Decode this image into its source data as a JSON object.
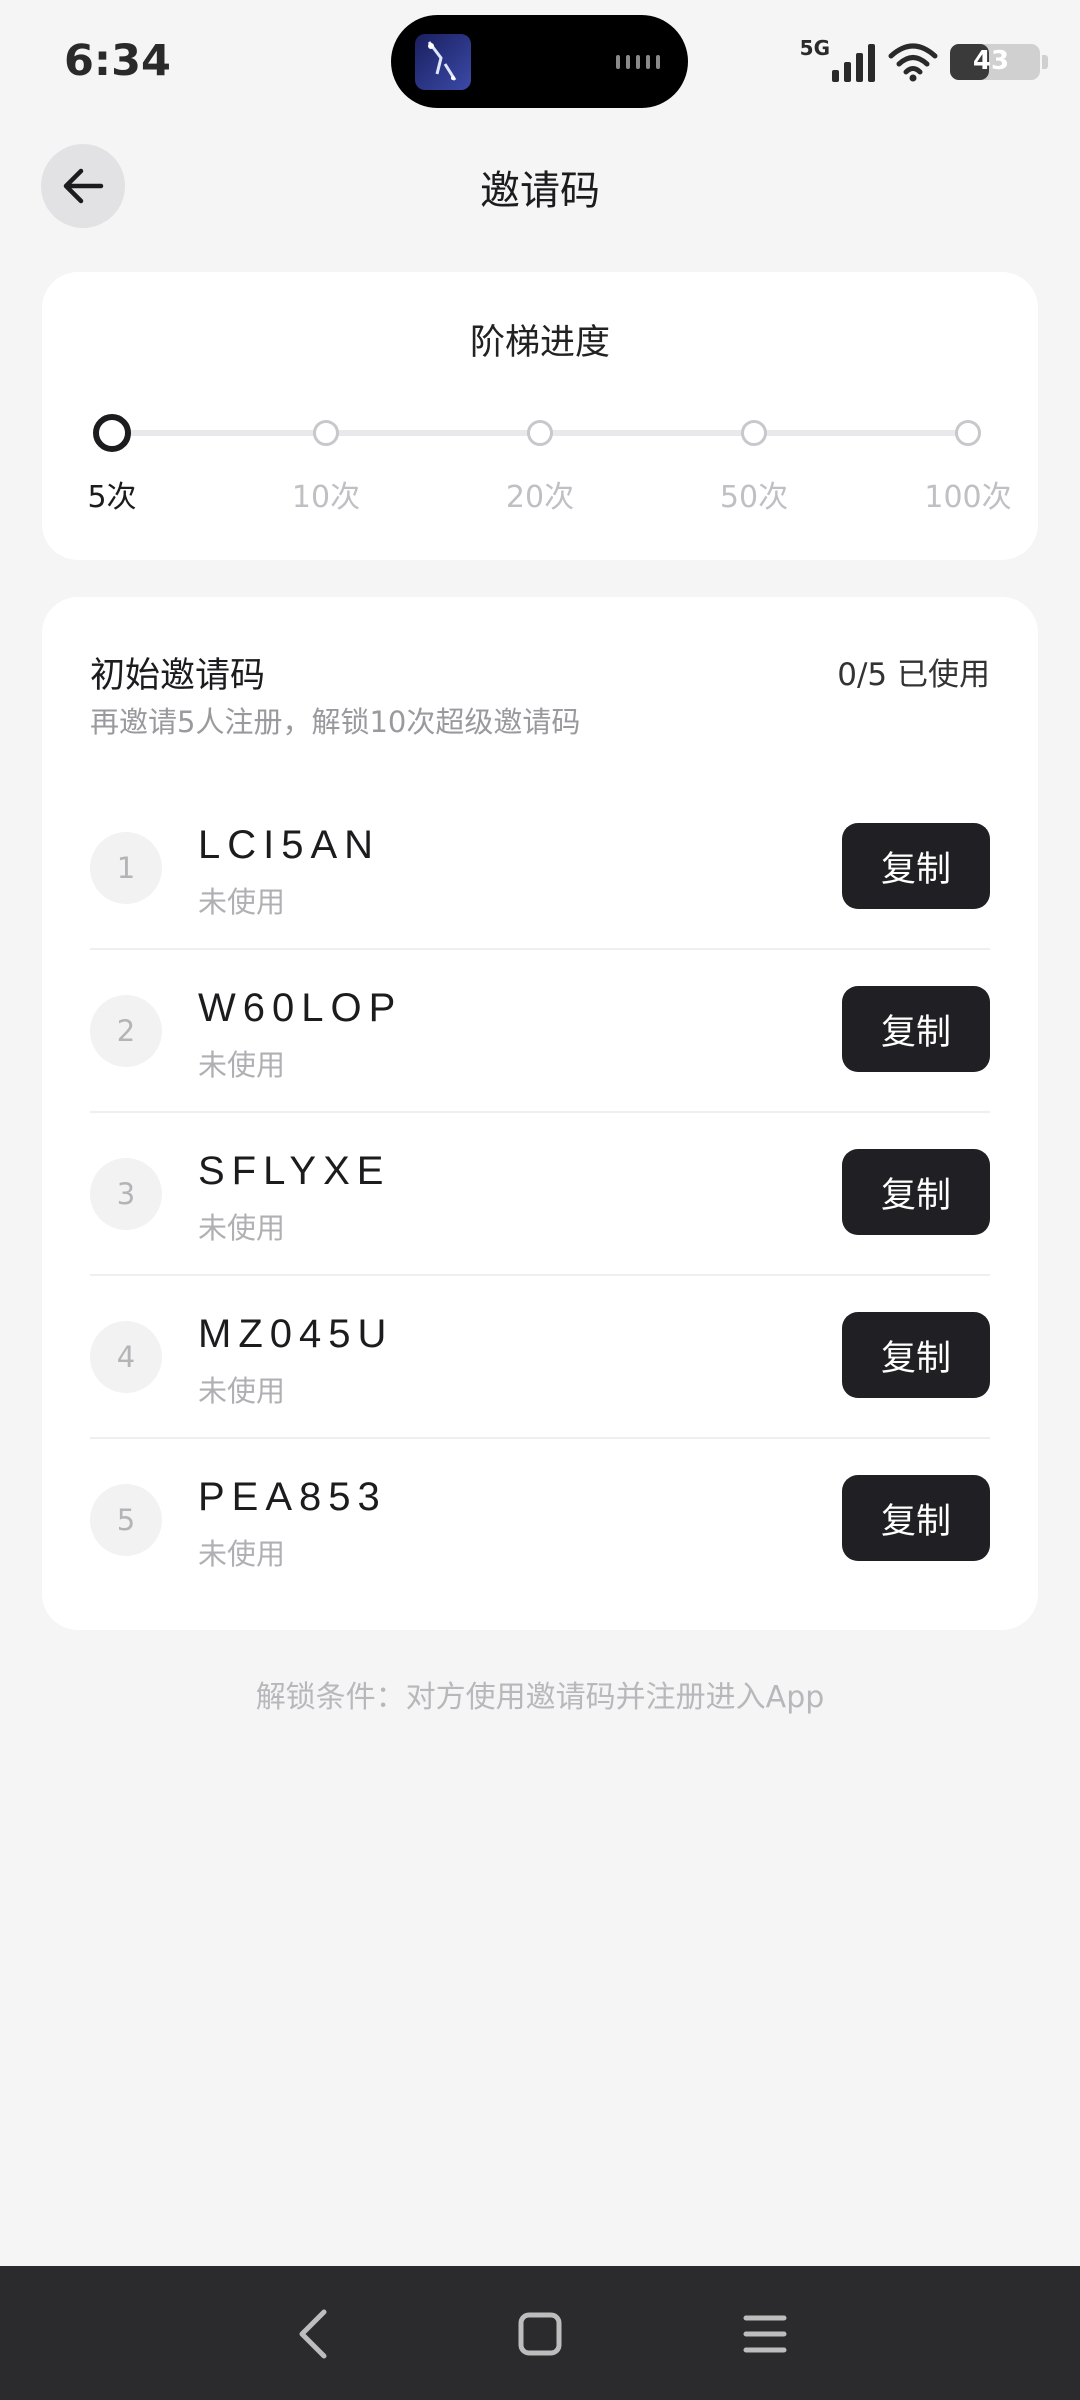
{
  "status_bar": {
    "time": "6:34",
    "network": "5G",
    "battery": "43",
    "battery_level": 0.43
  },
  "header": {
    "title": "邀请码"
  },
  "ladder": {
    "title": "阶梯进度",
    "steps": [
      "5次",
      "10次",
      "20次",
      "50次",
      "100次"
    ],
    "current_step_index": 0
  },
  "codes": {
    "heading": "初始邀请码",
    "usage": "0/5 已使用",
    "subtitle": "再邀请5人注册，解锁10次超级邀请码",
    "copy_label": "复制",
    "items": [
      {
        "index": "1",
        "code": "LCI5AN",
        "status": "未使用"
      },
      {
        "index": "2",
        "code": "W60LOP",
        "status": "未使用"
      },
      {
        "index": "3",
        "code": "SFLYXE",
        "status": "未使用"
      },
      {
        "index": "4",
        "code": "MZ045U",
        "status": "未使用"
      },
      {
        "index": "5",
        "code": "PEA853",
        "status": "未使用"
      }
    ]
  },
  "footer": {
    "unlock_note": "解锁条件：对方使用邀请码并注册进入App"
  },
  "nav": {
    "icons": [
      "back-icon",
      "home-icon",
      "menu-icon"
    ]
  }
}
